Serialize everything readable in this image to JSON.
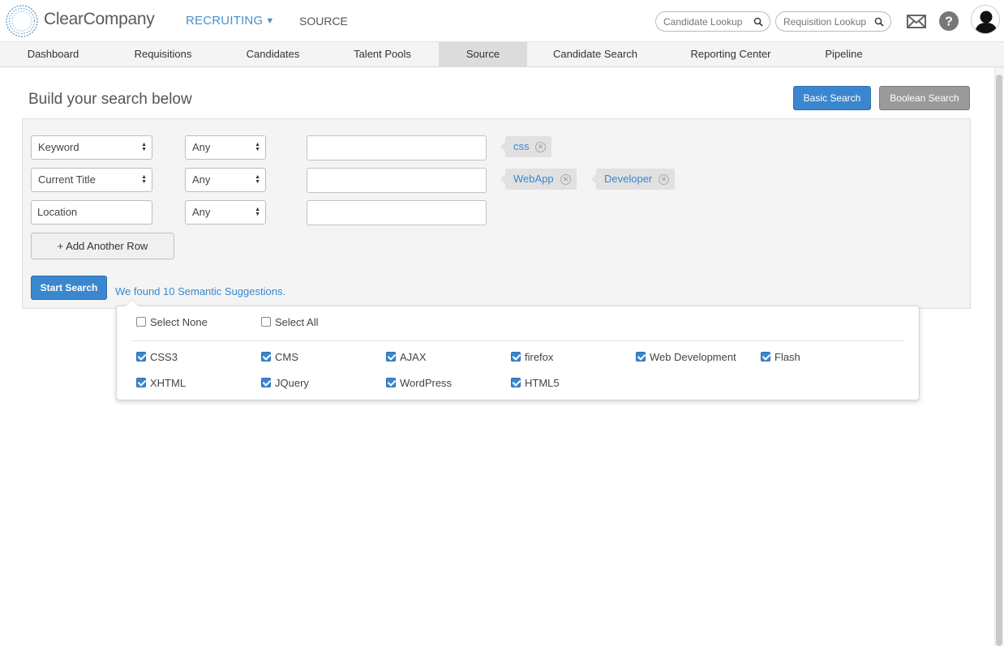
{
  "header": {
    "brand": "ClearCompany",
    "module": "RECRUITING",
    "module_caret": "▼",
    "source_link": "SOURCE",
    "candidate_lookup_placeholder": "Candidate Lookup",
    "requisition_lookup_placeholder": "Requisition Lookup",
    "icons": [
      "mail-icon",
      "help-icon",
      "user-avatar"
    ]
  },
  "nav": {
    "items": [
      {
        "label": "Dashboard"
      },
      {
        "label": "Requisitions"
      },
      {
        "label": "Candidates"
      },
      {
        "label": "Talent Pools"
      },
      {
        "label": "Source",
        "active": true
      },
      {
        "label": "Candidate Search"
      },
      {
        "label": "Reporting Center"
      },
      {
        "label": "Pipeline"
      }
    ]
  },
  "page": {
    "title": "Build your search below",
    "basic_search_label": "Basic Search",
    "boolean_search_label": "Boolean Search"
  },
  "rows": [
    {
      "field": "Keyword",
      "match": "Any",
      "value": "",
      "tags": [
        "css"
      ]
    },
    {
      "field": "Current Title",
      "match": "Any",
      "value": "",
      "tags": [
        "WebApp",
        "Developer"
      ]
    },
    {
      "field": "Location",
      "match": "Any",
      "value": "",
      "tags": []
    }
  ],
  "actions": {
    "add_row_label": "+ Add Another Row",
    "start_search_label": "Start Search",
    "found_text": "We found 10 Semantic Suggestions."
  },
  "suggestions": {
    "select_none": "Select None",
    "select_all": "Select All",
    "items": [
      {
        "label": "CSS3",
        "checked": true
      },
      {
        "label": "CMS",
        "checked": true
      },
      {
        "label": "AJAX",
        "checked": true
      },
      {
        "label": "firefox",
        "checked": true
      },
      {
        "label": "Web Development",
        "checked": true
      },
      {
        "label": "Flash",
        "checked": true
      },
      {
        "label": "XHTML",
        "checked": true
      },
      {
        "label": "JQuery",
        "checked": true
      },
      {
        "label": "WordPress",
        "checked": true
      },
      {
        "label": "HTML5",
        "checked": true
      }
    ]
  },
  "colors": {
    "accent": "#3a87cf",
    "boolean_button": "#9a9a9a",
    "tag_bg": "#e1e1e1"
  }
}
